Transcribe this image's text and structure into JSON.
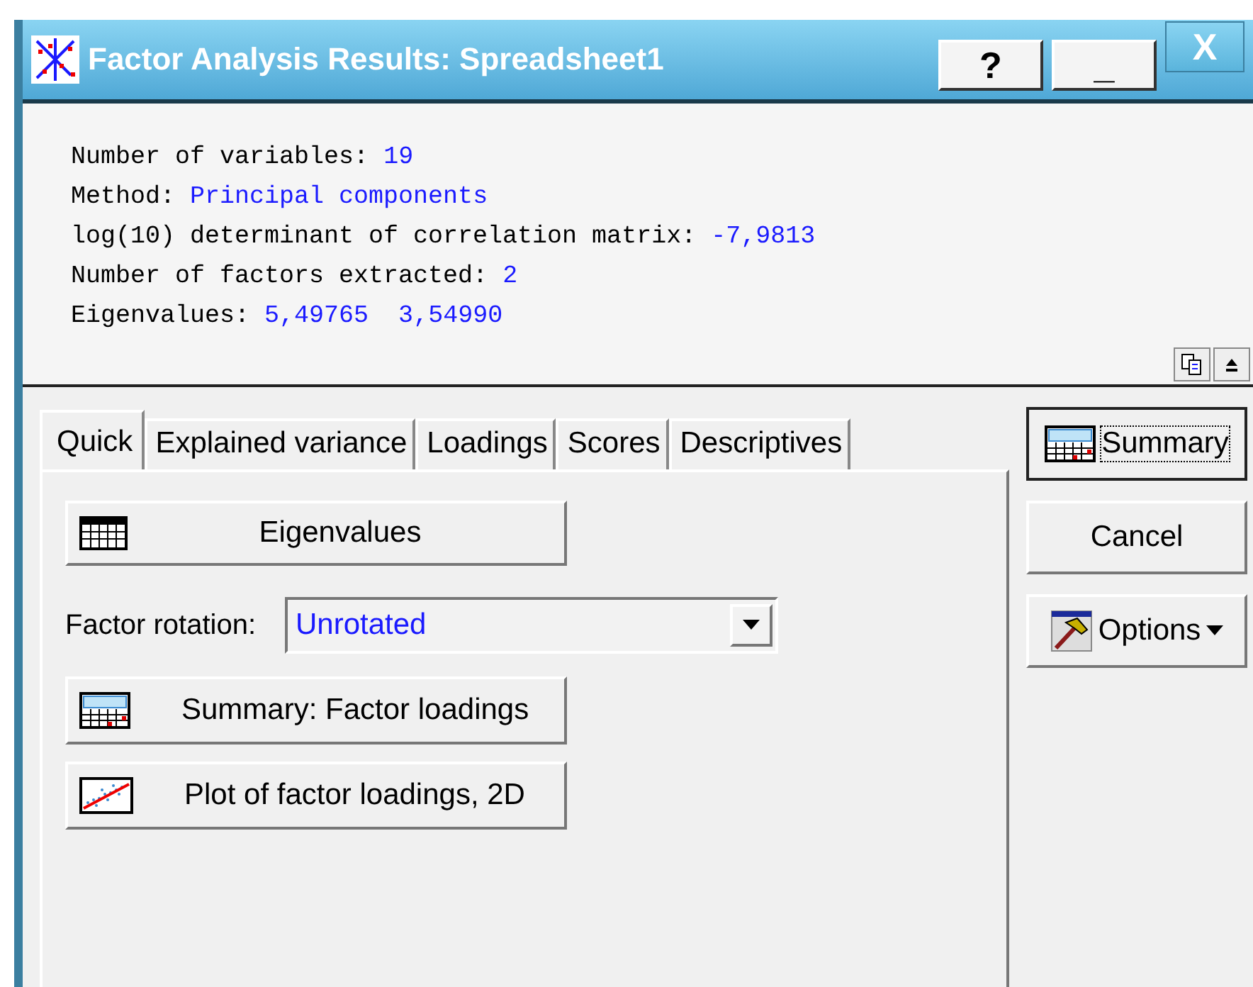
{
  "window": {
    "title": "Factor Analysis Results: Spreadsheet1",
    "title_buttons": [
      "?",
      "_",
      "X"
    ]
  },
  "info": [
    {
      "label": "Number of variables:",
      "value": "19"
    },
    {
      "label": "Method:",
      "value": "Principal components"
    },
    {
      "label": "log(10) determinant of correlation matrix:",
      "value": "-7,9813"
    },
    {
      "label": "Number of factors extracted:",
      "value": "2"
    },
    {
      "label": "Eigenvalues:",
      "value": "5,49765  3,54990"
    }
  ],
  "tabs": [
    {
      "label": "Quick",
      "selected": true
    },
    {
      "label": "Explained variance",
      "selected": false
    },
    {
      "label": "Loadings",
      "selected": false
    },
    {
      "label": "Scores",
      "selected": false
    },
    {
      "label": "Descriptives",
      "selected": false
    }
  ],
  "quick": {
    "eigen_button": {
      "label": "Eigenvalues"
    },
    "rotation": {
      "label": "Factor rotation:",
      "value": "Unrotated"
    },
    "buttons": [
      {
        "label": "Summary: Factor loadings",
        "kind": "summary"
      },
      {
        "label": "Plot of factor loadings, 2D",
        "kind": "plot"
      }
    ]
  },
  "side_buttons": [
    {
      "label": "Summary",
      "kind": "summary",
      "focused": true
    },
    {
      "label": "Cancel",
      "kind": "plain",
      "focused": false
    },
    {
      "label": "Options",
      "kind": "options",
      "focused": false
    }
  ]
}
